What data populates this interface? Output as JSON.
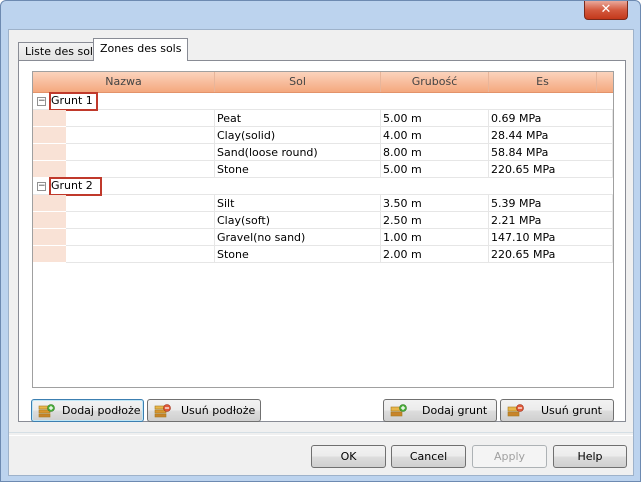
{
  "window": {
    "close_glyph": "✕"
  },
  "tabs": [
    {
      "label": "Liste des sols",
      "active": false
    },
    {
      "label": "Zones des sols",
      "active": true
    }
  ],
  "grid": {
    "columns": [
      "Nazwa",
      "Sol",
      "Grubość",
      "Es"
    ],
    "groups": [
      {
        "name": "Grunt 1",
        "rows": [
          {
            "sol": "Peat",
            "thickness": "5.00 m",
            "es": "0.69 MPa"
          },
          {
            "sol": "Clay(solid)",
            "thickness": "4.00 m",
            "es": "28.44 MPa"
          },
          {
            "sol": "Sand(loose round)",
            "thickness": "8.00 m",
            "es": "58.84 MPa"
          },
          {
            "sol": "Stone",
            "thickness": "5.00 m",
            "es": "220.65 MPa"
          }
        ]
      },
      {
        "name": "Grunt 2",
        "rows": [
          {
            "sol": "Silt",
            "thickness": "3.50 m",
            "es": "5.39 MPa"
          },
          {
            "sol": "Clay(soft)",
            "thickness": "2.50 m",
            "es": "2.21 MPa"
          },
          {
            "sol": "Gravel(no sand)",
            "thickness": "1.00 m",
            "es": "147.10 MPa"
          },
          {
            "sol": "Stone",
            "thickness": "2.00 m",
            "es": "220.65 MPa"
          }
        ]
      }
    ],
    "expander_glyph": "−",
    "header_color": "#f4a87e",
    "highlight_color": "#c0392b"
  },
  "actions": {
    "add_substrate": "Dodaj podłoże",
    "remove_substrate": "Usuń podłoże",
    "add_soil": "Dodaj grunt",
    "remove_soil": "Usuń grunt"
  },
  "dialog_buttons": {
    "ok": "OK",
    "cancel": "Cancel",
    "apply": "Apply",
    "help": "Help"
  }
}
